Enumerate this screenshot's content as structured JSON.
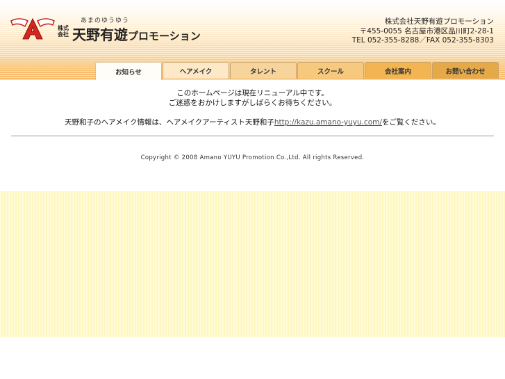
{
  "header": {
    "logo": {
      "ruby": "あまのゆうゆう",
      "kabushiki": "株式会社",
      "company_main": "天野有遊",
      "company_sub": "プロモーション"
    },
    "address": {
      "line1": "株式会社天野有遊プロモーション",
      "line2": "〒455-0055 名古屋市港区品川町2-28-1",
      "line3": "TEL 052-355-8288／FAX 052-355-8303"
    }
  },
  "nav": {
    "tabs": [
      {
        "label": "お知らせ"
      },
      {
        "label": "ヘアメイク"
      },
      {
        "label": "タレント"
      },
      {
        "label": "スクール"
      },
      {
        "label": "会社案内"
      },
      {
        "label": "お問い合わせ"
      }
    ]
  },
  "notice": {
    "line1": "このホームページは現在リニューアル中です。",
    "line2": "ご迷惑をおかけしますがしばらくお待ちください。",
    "line3_before": "天野和子のヘアメイク情報は、ヘアメイクアーティスト天野和子",
    "link": "http://kazu.amano-yuyu.com/",
    "line3_after": "をご覧ください。"
  },
  "footer": {
    "copyright": "Copyright © 2008 Amano YUYU Promotion Co.,Ltd. All rights Reserved."
  },
  "colors": {
    "logo_red": "#d7261e",
    "header_orange": "#f6b55d",
    "panel_yellow": "#fff7c2"
  }
}
